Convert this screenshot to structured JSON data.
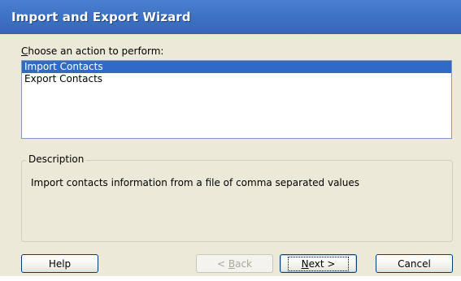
{
  "window": {
    "title": "Import and Export Wizard"
  },
  "prompt": {
    "mnemonic": "C",
    "rest": "hoose an action to perform:"
  },
  "actions": {
    "items": [
      {
        "label": "Import Contacts",
        "selected": true
      },
      {
        "label": "Export Contacts",
        "selected": false
      }
    ]
  },
  "description": {
    "legend": "Description",
    "text": "Import contacts information from a file of comma separated values"
  },
  "buttons": {
    "help": "Help",
    "back_prefix": "< ",
    "back_mnemonic": "B",
    "back_rest": "ack",
    "next_mnemonic": "N",
    "next_rest": "ext >",
    "cancel": "Cancel"
  },
  "colors": {
    "title_bar": "#3f73c4",
    "dialog_face": "#ece9d8",
    "selection": "#316ac5",
    "button_border": "#003c74"
  }
}
